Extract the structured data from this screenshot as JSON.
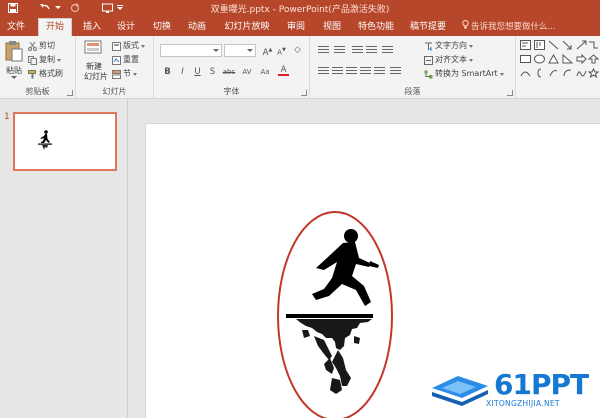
{
  "window": {
    "title": "双重曝光.pptx - PowerPoint(产品激活失败)"
  },
  "tabs": [
    {
      "label": "文件"
    },
    {
      "label": "开始"
    },
    {
      "label": "插入"
    },
    {
      "label": "设计"
    },
    {
      "label": "切换"
    },
    {
      "label": "动画"
    },
    {
      "label": "幻灯片放映"
    },
    {
      "label": "审阅"
    },
    {
      "label": "视图"
    },
    {
      "label": "特色功能"
    },
    {
      "label": "稿节提要"
    }
  ],
  "tell_me": {
    "placeholder": "告诉我您想要做什么..."
  },
  "ribbon": {
    "clipboard": {
      "label": "剪贴板",
      "paste": "粘贴",
      "cut": "剪切",
      "copy": "复制",
      "format_painter": "格式刷"
    },
    "slides": {
      "label": "幻灯片",
      "new_slide_line1": "新建",
      "new_slide_line2": "幻灯片",
      "layout": "版式",
      "reset": "重置",
      "section": "节"
    },
    "font": {
      "label": "字体",
      "glyphs": [
        "B",
        "I",
        "U",
        "S",
        "abc",
        "AV",
        "Aa",
        "A"
      ]
    },
    "paragraph": {
      "label": "段落",
      "text_direction": "文字方向",
      "align_text": "对齐文本",
      "convert_smartart": "转换为 SmartArt"
    }
  },
  "thumbnails": [
    {
      "number": "1"
    }
  ],
  "colors": {
    "accent": "#b7472a",
    "ellipse": "#c0392b",
    "selection": "#e0775a"
  },
  "watermark": {
    "brand": "61PPT",
    "url": "XITONGZHIJIA.NET"
  }
}
